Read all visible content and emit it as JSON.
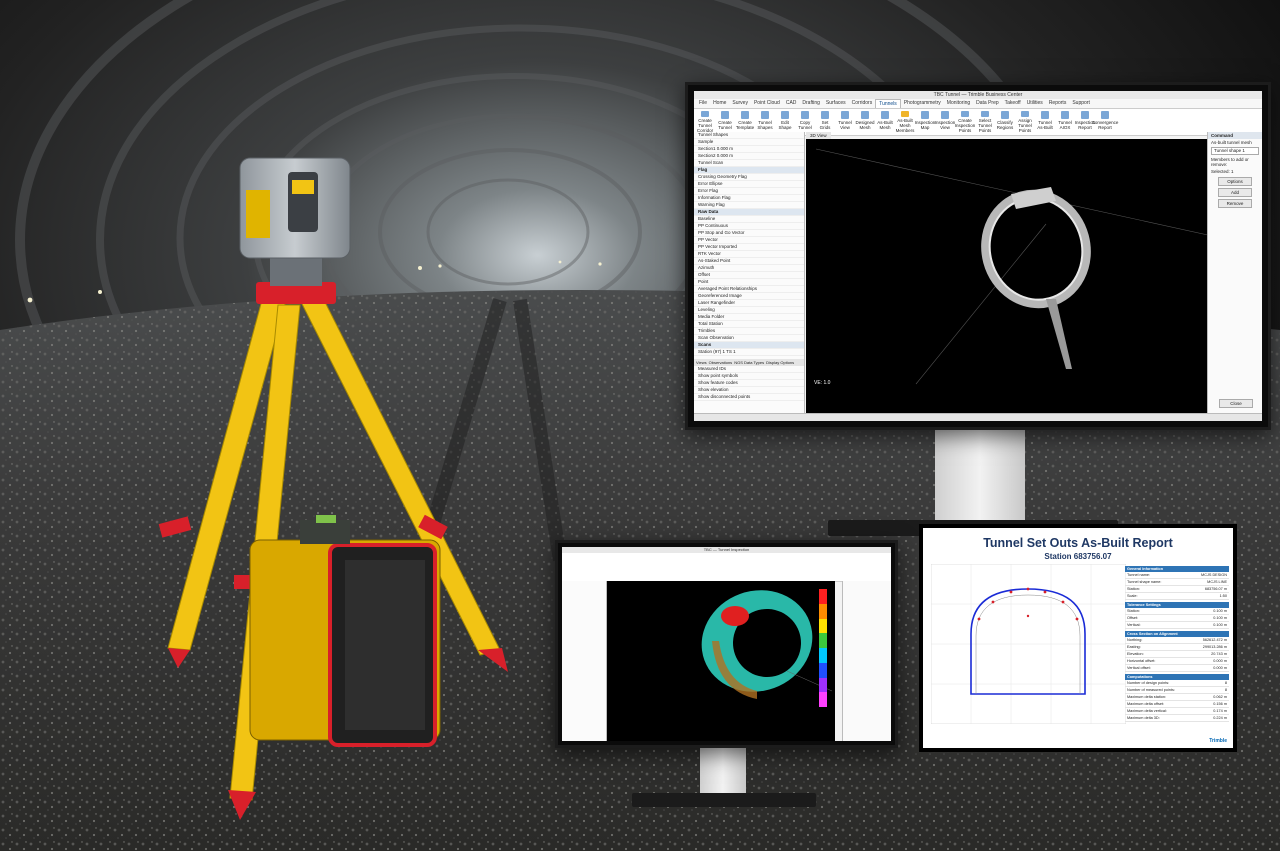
{
  "scene": {
    "description_objects": [
      "tripod-scanner",
      "tunnel-background",
      "desktop-monitor-large",
      "desktop-monitor-small",
      "report-sheet"
    ]
  },
  "monitor_large": {
    "window_title": "TBC Tunnel — Trimble Business Center",
    "tabs": [
      "File",
      "Home",
      "Survey",
      "Point Cloud",
      "CAD",
      "Drafting",
      "Surfaces",
      "Corridors",
      "Tunnels",
      "Photogrammetry",
      "Monitoring",
      "Data Prep",
      "Takeoff",
      "Utilities",
      "Reports",
      "Support"
    ],
    "active_tab": "Tunnels",
    "ribbon_buttons": [
      "Create Tunnel Corridor",
      "Create Tunnel",
      "Create Template",
      "Tunnel Shapes",
      "Edit Shape",
      "Copy Tunnel",
      "Set Grids",
      "Tunnel View",
      "Designed Mesh",
      "As-Built Mesh",
      "As-Built Mesh Members",
      "Inspection Map",
      "Inspection View",
      "Create Inspection Points",
      "Select Tunnel Points",
      "Classify Regions",
      "Assign Tunnel Points",
      "Tunnel As-Built",
      "Tunnel AIOX",
      "Inspection Report",
      "Convergence Report"
    ],
    "highlight_button": "As-Built Mesh Members",
    "tree_rows": [
      {
        "label": "Tunnel Shapes",
        "section": false
      },
      {
        "label": "Sample",
        "section": false
      },
      {
        "label": "Section1 0.000 m",
        "section": false
      },
      {
        "label": "Section2 0.000 m",
        "section": false
      },
      {
        "label": "Tunnel Scan",
        "section": false
      },
      {
        "label": "Flag",
        "section": true
      },
      {
        "label": "Crossing Geometry Flag",
        "section": false
      },
      {
        "label": "Error Ellipse",
        "section": false
      },
      {
        "label": "Error Flag",
        "section": false
      },
      {
        "label": "Information Flag",
        "section": false
      },
      {
        "label": "Warning Flag",
        "section": false
      },
      {
        "label": "Raw Data",
        "section": true
      },
      {
        "label": "Baseline",
        "section": false
      },
      {
        "label": "PP Continuous",
        "section": false
      },
      {
        "label": "PP Stop and Go Vector",
        "section": false
      },
      {
        "label": "PP Vector",
        "section": false
      },
      {
        "label": "PP Vector Imported",
        "section": false
      },
      {
        "label": "RTK Vector",
        "section": false
      },
      {
        "label": "As-Staked Point",
        "section": false
      },
      {
        "label": "Azimuth",
        "section": false
      },
      {
        "label": "Offset",
        "section": false
      },
      {
        "label": "Point",
        "section": false
      },
      {
        "label": "Averaged Point Relationships",
        "section": false
      },
      {
        "label": "Georeferenced Image",
        "section": false
      },
      {
        "label": "Laser Rangefinder",
        "section": false
      },
      {
        "label": "Leveling",
        "section": false
      },
      {
        "label": "Media Folder",
        "section": false
      },
      {
        "label": "Total Station",
        "section": false
      },
      {
        "label": "Trimbles",
        "section": false
      },
      {
        "label": "Scan Observation",
        "section": false
      },
      {
        "label": "Scans",
        "section": true
      },
      {
        "label": "Station (97) 1 TS 1",
        "section": false
      }
    ],
    "panel_tabs": [
      "Views",
      "Observations",
      "NGS Data Types",
      "Display Options"
    ],
    "checkboxes": [
      "Measured IDs",
      "Show point symbols",
      "Show feature codes",
      "Show elevation",
      "Show disconnected points"
    ],
    "viewport_tab": "3D View",
    "command_panel": {
      "header": "Command",
      "title": "As-built tunnel mesh",
      "field_value": "Tunnel shape 1",
      "members_label": "Members to add or remove:",
      "selected_label": "Selected: 1",
      "options_btn": "Options",
      "add_btn": "Add",
      "remove_btn": "Remove",
      "close_btn": "Close"
    },
    "scale_label": "VE: 1.0"
  },
  "monitor_small": {
    "window_title": "TBC — Tunnel Inspection",
    "legend_colors": [
      "#ff2020",
      "#ff8c00",
      "#ffe000",
      "#3cc83c",
      "#00c8ff",
      "#2050ff",
      "#a030ff",
      "#ff40ff"
    ]
  },
  "report": {
    "title": "Tunnel Set Outs As-Built Report",
    "subtitle": "Station 683756.07",
    "sections": [
      {
        "header": "General Information",
        "rows": [
          [
            "Tunnel name:",
            "MCJS DESIGN"
          ],
          [
            "Tunnel shape name:",
            "MCJS LINE"
          ],
          [
            "Station:",
            "683756.07 m"
          ],
          [
            "Scale:",
            "1:50"
          ]
        ]
      },
      {
        "header": "Tolerance Settings",
        "rows": [
          [
            "Station:",
            "0.100 m"
          ],
          [
            "Offset:",
            "0.100 m"
          ],
          [
            "Vertical:",
            "0.100 m"
          ]
        ]
      },
      {
        "header": "Cross Section on Alignment",
        "rows": [
          [
            "Northing:",
            "562612.472 m"
          ],
          [
            "Easting:",
            "299013.286 m"
          ],
          [
            "Elevation:",
            "20.743 m"
          ],
          [
            "Horizontal offset:",
            "0.000 m"
          ],
          [
            "Vertical offset:",
            "0.000 m"
          ]
        ]
      },
      {
        "header": "Computations",
        "rows": [
          [
            "Number of design points:",
            "8"
          ],
          [
            "Number of measured points:",
            "8"
          ],
          [
            "Maximum delta station:",
            "0.062 m"
          ],
          [
            "Maximum delta offset:",
            "0.156 m"
          ],
          [
            "Maximum delta vertical:",
            "0.174 m"
          ],
          [
            "Maximum delta 3D:",
            "0.224 m"
          ]
        ]
      }
    ],
    "logo": "Trimble"
  },
  "colors": {
    "tripod_yellow": "#f2c414",
    "tripod_red": "#d8202a",
    "report_blue": "#1f3864",
    "report_header": "#2e74b5",
    "profile_blue": "#1a2bd6"
  }
}
